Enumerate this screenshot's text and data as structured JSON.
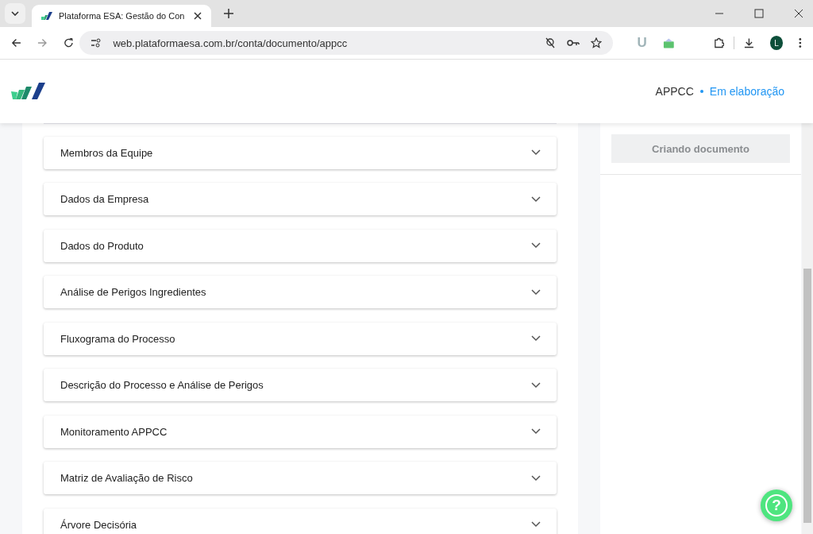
{
  "browser": {
    "tab_title": "Plataforma ESA: Gestão do Con",
    "url": "web.plataformaesa.com.br/conta/documento/appcc",
    "extension_letter": "U",
    "profile_initial": "L"
  },
  "header": {
    "document_type": "APPCC",
    "status": "Em elaboração"
  },
  "sections": [
    {
      "title": "Membros da Equipe",
      "expanded": false
    },
    {
      "title": "Dados da Empresa",
      "expanded": false
    },
    {
      "title": "Dados do Produto",
      "expanded": false
    },
    {
      "title": "Análise de Perigos Ingredientes",
      "expanded": false
    },
    {
      "title": "Fluxograma do Processo",
      "expanded": false
    },
    {
      "title": "Descrição do Processo e Análise de Perigos",
      "expanded": false
    },
    {
      "title": "Monitoramento APPCC",
      "expanded": false
    },
    {
      "title": "Matriz de Avaliação de Risco",
      "expanded": false
    },
    {
      "title": "Árvore Decisória",
      "expanded": false
    }
  ],
  "side_panel": {
    "button": "Criando documento",
    "disabled": true
  },
  "help": {
    "label": "?"
  }
}
